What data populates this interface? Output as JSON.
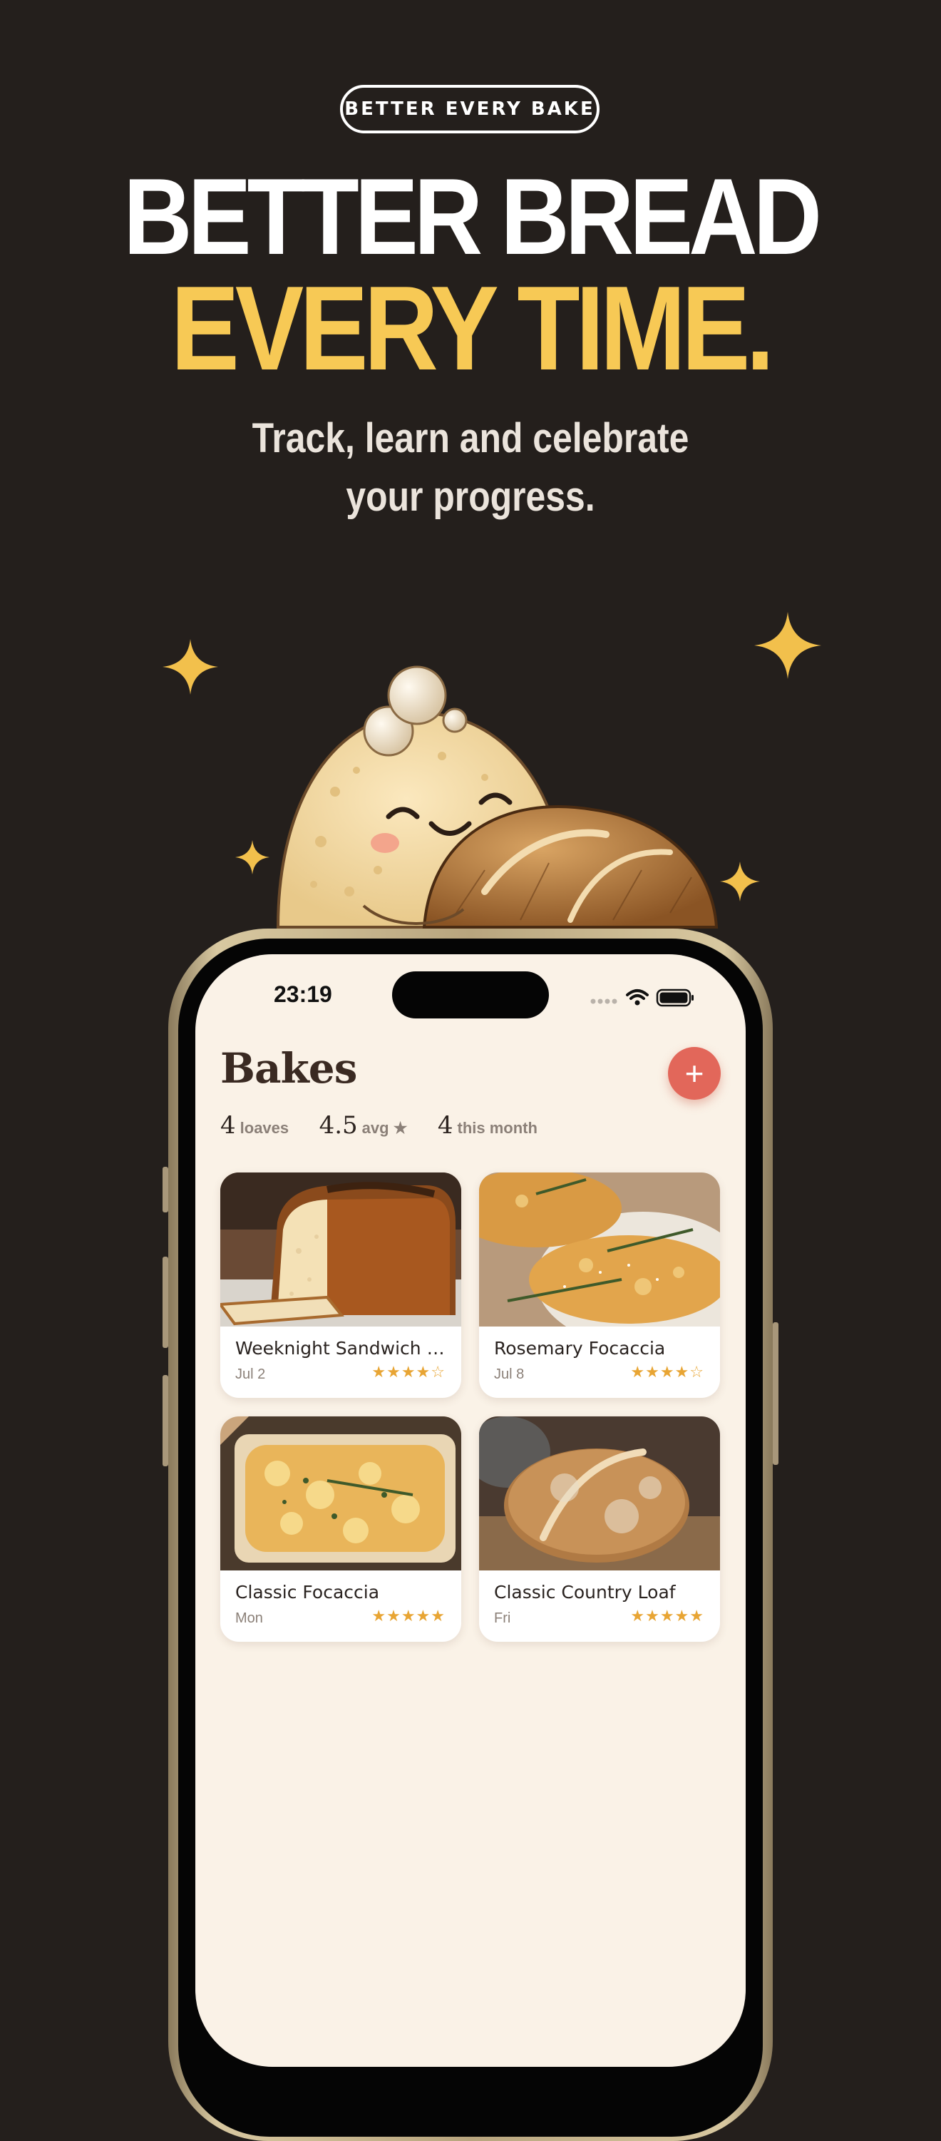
{
  "promo": {
    "badge": "BETTER EVERY BAKE",
    "headline_line1": "BETTER BREAD",
    "headline_line2": "EVERY TIME.",
    "subtitle_line1": "Track, learn and celebrate",
    "subtitle_line2": "your progress.",
    "colors": {
      "background": "#241f1c",
      "accent": "#f7c955",
      "sparkle": "#f2c04c"
    }
  },
  "status_bar": {
    "time": "23:19"
  },
  "header": {
    "title": "Bakes",
    "add_label": "+"
  },
  "stats": [
    {
      "value": "4",
      "label": "loaves"
    },
    {
      "value": "4.5",
      "label": "avg ★"
    },
    {
      "value": "4",
      "label": "this month"
    }
  ],
  "bakes": [
    {
      "name": "Weeknight Sandwich L...",
      "date": "Jul 2",
      "rating": 4,
      "stars": "★★★★☆",
      "photo": "sandwich-loaf-photo"
    },
    {
      "name": "Rosemary Focaccia",
      "date": "Jul 8",
      "rating": 4,
      "stars": "★★★★☆",
      "photo": "rosemary-focaccia-photo"
    },
    {
      "name": "Classic Focaccia",
      "date": "Mon",
      "rating": 5,
      "stars": "★★★★★",
      "photo": "classic-focaccia-photo"
    },
    {
      "name": "Classic Country Loaf",
      "date": "Fri",
      "rating": 5,
      "stars": "★★★★★",
      "photo": "country-loaf-photo"
    }
  ],
  "colors": {
    "screen_bg": "#faf2e7",
    "add_button": "#e2675a",
    "star": "#e8a534",
    "title": "#3a2a22"
  }
}
